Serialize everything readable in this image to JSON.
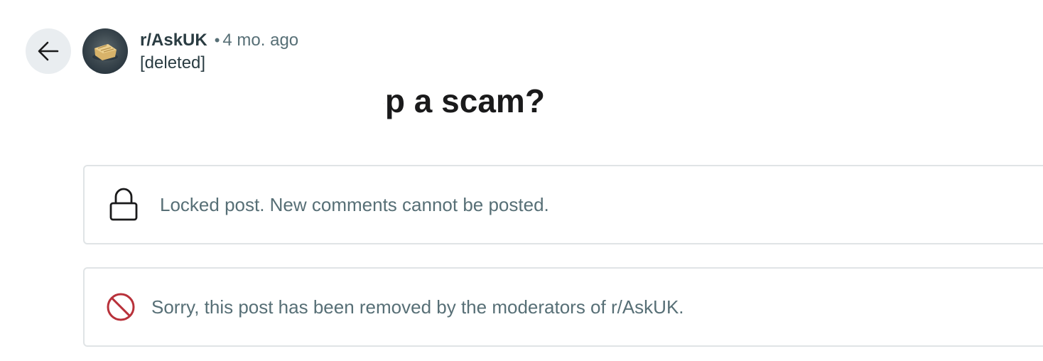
{
  "post": {
    "subreddit": "r/AskUK",
    "separator": "•",
    "time_ago": "4 mo. ago",
    "author": "[deleted]",
    "title_visible": "betting app a scam?"
  },
  "notices": {
    "locked_text": "Locked post. New comments cannot be posted.",
    "removed_text": "Sorry, this post has been removed by the moderators of r/AskUK."
  },
  "icons": {
    "back": "arrow-left-icon",
    "lock": "lock-icon",
    "removed": "prohibited-icon"
  },
  "colors": {
    "removed_icon": "#b8313a",
    "muted_text": "#576f76",
    "back_button_bg": "#e9edf0"
  }
}
